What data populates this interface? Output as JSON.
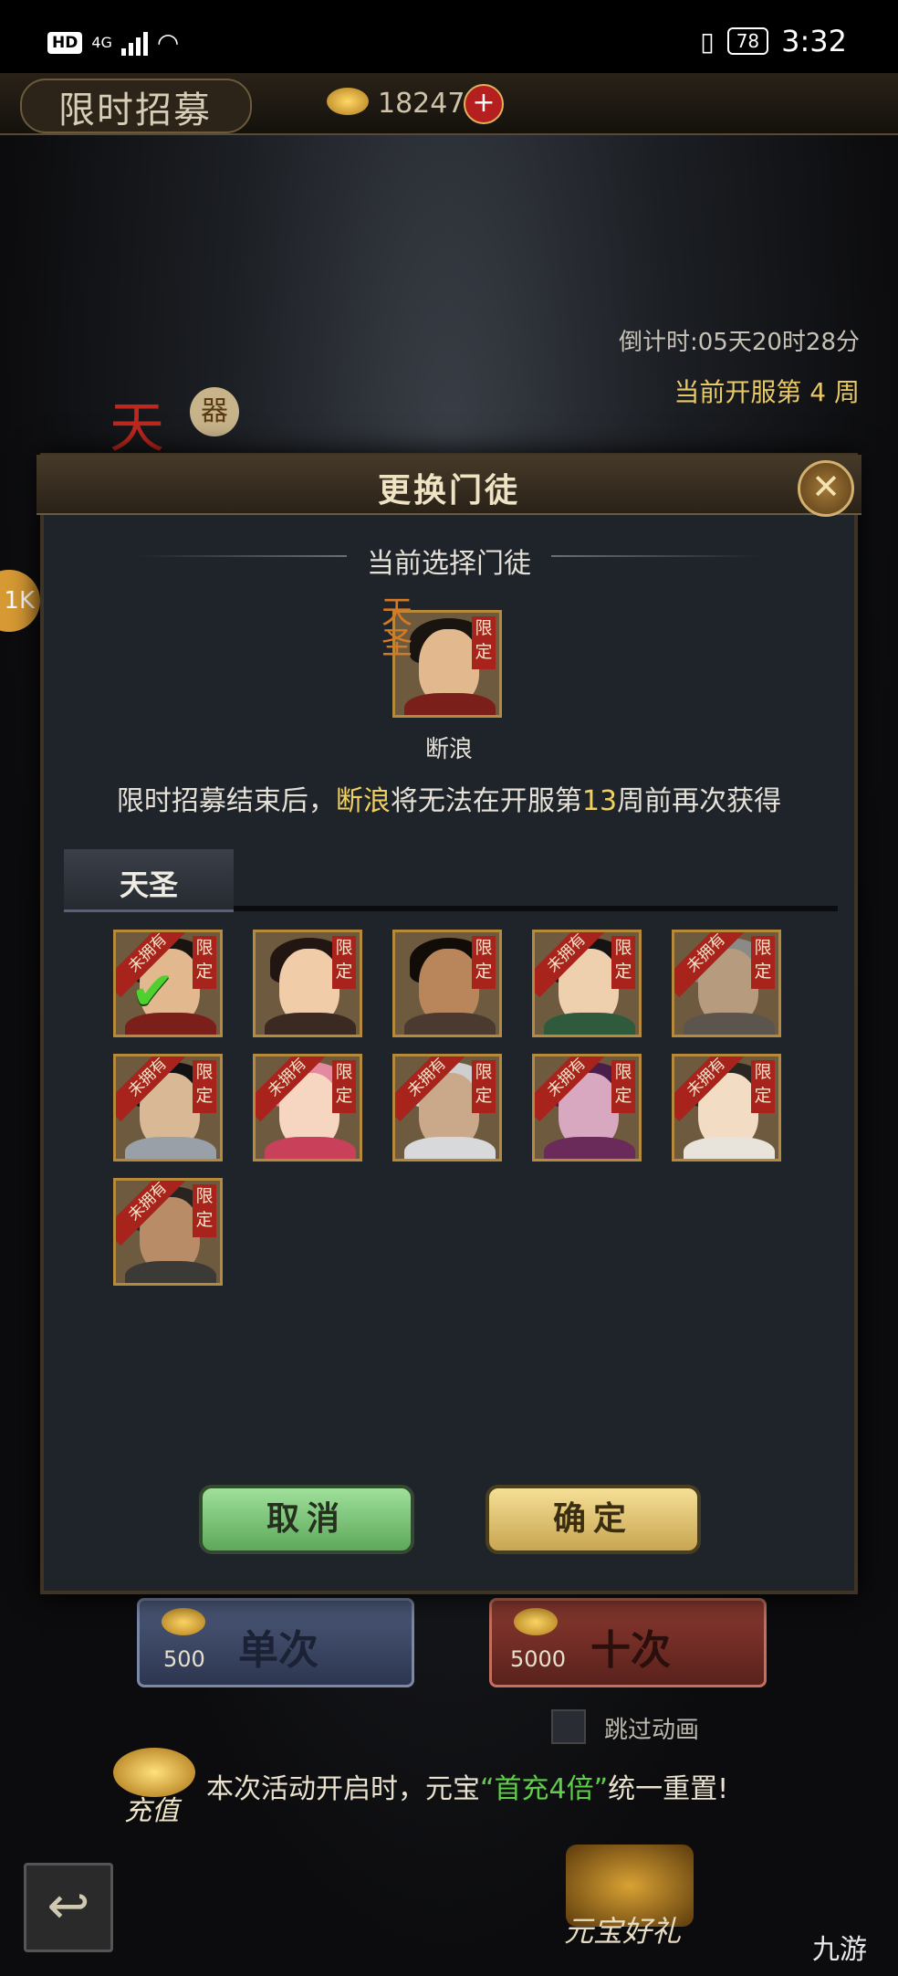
{
  "status_bar": {
    "hd": "HD",
    "network": "4G",
    "battery": "78",
    "time": "3:32"
  },
  "header": {
    "title": "限时招募",
    "gold_amount": "18247",
    "plus": "+"
  },
  "event": {
    "countdown": "倒计时:05天20时28分",
    "week": "当前开服第 4 周",
    "grade_char": "天",
    "badge_char": "器",
    "side_badge": "1K"
  },
  "dialog": {
    "title": "更换门徒",
    "close": "✕",
    "current_heading": "当前选择门徒",
    "current_grade": "天圣",
    "current_name": "断浪",
    "limit_tag": "限定",
    "notice_prefix": "限时招募结束后，",
    "notice_name": "断浪",
    "notice_mid": "将无法在开服第",
    "notice_week": "13",
    "notice_suffix": "周前再次获得",
    "tab_label": "天圣",
    "cancel": "取消",
    "confirm": "确定",
    "unowned_tag": "未拥有",
    "disciples": [
      {
        "unowned": true,
        "selected": true,
        "skin": "#e2b98f",
        "robe": "#7a1f1a",
        "hair": "#1a1410"
      },
      {
        "unowned": false,
        "selected": false,
        "skin": "#f0cda8",
        "robe": "#3a2a22",
        "hair": "#221612"
      },
      {
        "unowned": false,
        "selected": false,
        "skin": "#b9855a",
        "robe": "#4a3a30",
        "hair": "#120c08"
      },
      {
        "unowned": true,
        "selected": false,
        "skin": "#efd0ae",
        "robe": "#2f5a3c",
        "hair": "#141414"
      },
      {
        "unowned": true,
        "selected": false,
        "skin": "#b79b7f",
        "robe": "#5b554e",
        "hair": "#8a8a86"
      },
      {
        "unowned": true,
        "selected": false,
        "skin": "#d9b896",
        "robe": "#9aa0a8",
        "hair": "#121212"
      },
      {
        "unowned": true,
        "selected": false,
        "skin": "#f6d6c0",
        "robe": "#c8405a",
        "hair": "#e48aa0"
      },
      {
        "unowned": true,
        "selected": false,
        "skin": "#c9a98a",
        "robe": "#d7d9db",
        "hair": "#cfcfcf"
      },
      {
        "unowned": true,
        "selected": false,
        "skin": "#d8a8c0",
        "robe": "#6a2a5a",
        "hair": "#4a1e4a"
      },
      {
        "unowned": true,
        "selected": false,
        "skin": "#f2dcc4",
        "robe": "#e8e4dc",
        "hair": "#2a2622"
      },
      {
        "unowned": true,
        "selected": false,
        "skin": "#b78c66",
        "robe": "#3c3a36",
        "hair": "#2a2420"
      }
    ]
  },
  "recruit": {
    "single_label": "单次",
    "single_cost": "500",
    "ten_label": "十次",
    "ten_cost": "5000",
    "skip_animation": "跳过动画"
  },
  "promo": {
    "recharge_label": "充值",
    "notice_prefix": "本次活动开启时，元宝",
    "notice_highlight": "“首充4倍”",
    "notice_suffix": "统一重置!",
    "gift_label": "元宝好礼"
  },
  "nav": {
    "back": "↩"
  },
  "watermark": "九游",
  "colors": {
    "limit_red": "#a8231c",
    "gold_text": "#f0d060",
    "green_check": "#4fd02e",
    "frame_gold": "#b58a3c"
  }
}
